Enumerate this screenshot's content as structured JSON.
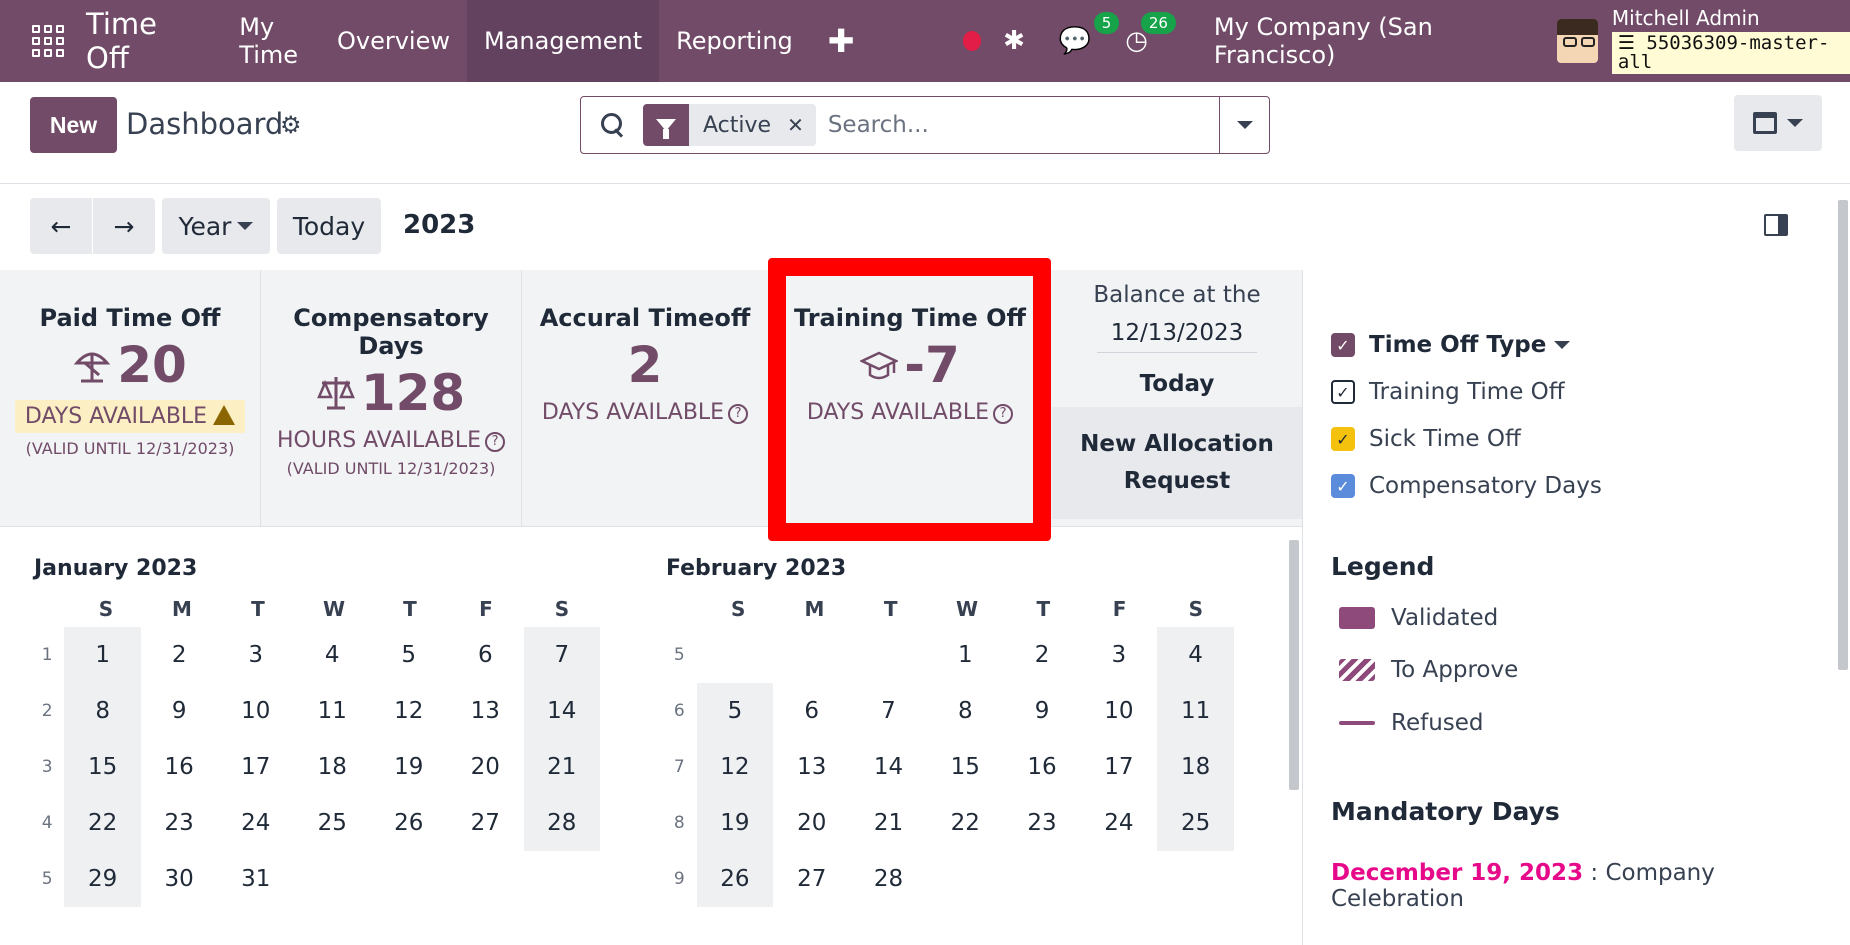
{
  "navbar": {
    "app_name": "Time Off",
    "menu": [
      "My Time",
      "Overview",
      "Management",
      "Reporting"
    ],
    "active_menu": "Management",
    "chat_badge": "5",
    "activity_badge": "26",
    "company": "My Company (San Francisco)",
    "user_name": "Mitchell Admin",
    "db_name": "55036309-master-all"
  },
  "control": {
    "new_label": "New",
    "title": "Dashboard",
    "facet_label": "Active",
    "search_placeholder": "Search..."
  },
  "toolbar": {
    "scale_label": "Year",
    "today_label": "Today",
    "year": "2023"
  },
  "cards": [
    {
      "title": "Paid Time Off",
      "value": "20",
      "unit": "DAYS AVAILABLE",
      "valid": "(VALID UNTIL 12/31/2023)",
      "icon": "umbrella-icon",
      "warning": true
    },
    {
      "title": "Compensatory Days",
      "value": "128",
      "unit": "HOURS AVAILABLE",
      "valid": "(VALID UNTIL 12/31/2023)",
      "icon": "scale-icon"
    },
    {
      "title": "Accural Timeoff",
      "value": "2",
      "unit": "DAYS AVAILABLE",
      "valid": ""
    },
    {
      "title": "Training Time Off",
      "value": "-7",
      "unit": "DAYS AVAILABLE",
      "valid": "",
      "icon": "graduation-cap-icon"
    }
  ],
  "balance": {
    "label": "Balance at the",
    "date": "12/13/2023",
    "today": "Today",
    "alloc_line1": "New Allocation",
    "alloc_line2": "Request"
  },
  "calendars": [
    {
      "title": "January 2023",
      "weekdays": [
        "S",
        "M",
        "T",
        "W",
        "T",
        "F",
        "S"
      ],
      "weeks": [
        {
          "n": "1",
          "days": [
            "1",
            "2",
            "3",
            "4",
            "5",
            "6",
            "7"
          ]
        },
        {
          "n": "2",
          "days": [
            "8",
            "9",
            "10",
            "11",
            "12",
            "13",
            "14"
          ]
        },
        {
          "n": "3",
          "days": [
            "15",
            "16",
            "17",
            "18",
            "19",
            "20",
            "21"
          ]
        },
        {
          "n": "4",
          "days": [
            "22",
            "23",
            "24",
            "25",
            "26",
            "27",
            "28"
          ]
        },
        {
          "n": "5",
          "days": [
            "29",
            "30",
            "31",
            "",
            "",
            "",
            ""
          ]
        }
      ]
    },
    {
      "title": "February 2023",
      "weekdays": [
        "S",
        "M",
        "T",
        "W",
        "T",
        "F",
        "S"
      ],
      "weeks": [
        {
          "n": "5",
          "days": [
            "",
            "",
            "",
            "1",
            "2",
            "3",
            "4"
          ]
        },
        {
          "n": "6",
          "days": [
            "5",
            "6",
            "7",
            "8",
            "9",
            "10",
            "11"
          ]
        },
        {
          "n": "7",
          "days": [
            "12",
            "13",
            "14",
            "15",
            "16",
            "17",
            "18"
          ]
        },
        {
          "n": "8",
          "days": [
            "19",
            "20",
            "21",
            "22",
            "23",
            "24",
            "25"
          ]
        },
        {
          "n": "9",
          "days": [
            "26",
            "27",
            "28",
            "",
            "",
            "",
            ""
          ]
        }
      ]
    }
  ],
  "side": {
    "filter_head": "Time Off Type",
    "filters": [
      {
        "label": "Training Time Off",
        "color": "#ffffff"
      },
      {
        "label": "Sick Time Off",
        "color": "#f4c20d"
      },
      {
        "label": "Compensatory Days",
        "color": "#5b8bdb"
      }
    ],
    "legend_head": "Legend",
    "legend": [
      {
        "label": "Validated",
        "style": "solid"
      },
      {
        "label": "To Approve",
        "style": "hatched"
      },
      {
        "label": "Refused",
        "style": "line"
      }
    ],
    "mandatory_head": "Mandatory Days",
    "mandatory_date": "December 19, 2023",
    "mandatory_sep": " : ",
    "mandatory_name": "Company Celebration"
  },
  "colors": {
    "brand": "#714B67",
    "highlight": "#ff0000",
    "mandatory": "#e60a8a"
  }
}
